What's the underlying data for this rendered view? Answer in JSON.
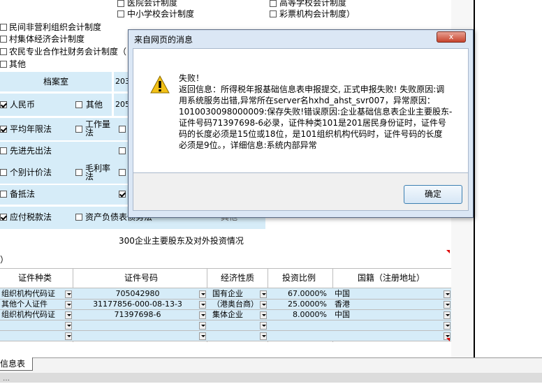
{
  "top_checks": [
    {
      "label": "医院会计制度",
      "checked": false
    },
    {
      "label": "高等学校会计制度",
      "checked": false
    },
    {
      "label": "中小学校会计制度",
      "checked": false
    },
    {
      "label": "彩票机构会计制度）",
      "checked": false
    }
  ],
  "left_checks": [
    {
      "label": "民间非营利组织会计制度",
      "checked": false
    },
    {
      "label": "村集体经济会计制度",
      "checked": false
    },
    {
      "label": "农民专业合作社财务会计制度（",
      "checked": false
    },
    {
      "label": "其他",
      "checked": false
    }
  ],
  "archive": {
    "label": "档案室",
    "value_partial": "203"
  },
  "currency": {
    "rmb": "人民币",
    "other": "其他",
    "value_partial": "205"
  },
  "methods": {
    "avg_life": "平均年限法",
    "workload": "工作量法",
    "fifo": "先进先出法",
    "individual": "个别计价法",
    "gross_margin": "毛利率法",
    "allowance": "备抵法",
    "tax_payable": "应付税款法",
    "balance_sheet_debt": "资产负债表债务法",
    "other_partial": "其他"
  },
  "section_title": "300企业主要股东及对外投资情况",
  "section_left_partial": "）",
  "table": {
    "headers": [
      "证件种类",
      "证件号码",
      "经济性质",
      "投资比例",
      "国籍（注册地址）"
    ],
    "rows": [
      {
        "type": "组织机构代码证",
        "number": "705042980",
        "nature": "国有企业",
        "ratio": "67.0000%",
        "country": "中国"
      },
      {
        "type": "其他个人证件",
        "number": "31177856-000-08-13-3",
        "nature": "（港奥台商）",
        "ratio": "25.0000%",
        "country": "香港"
      },
      {
        "type": "组织机构代码证",
        "number": "71397698-6",
        "nature": "集体企业",
        "ratio": "8.0000%",
        "country": "中国"
      },
      {
        "type": "",
        "number": "",
        "nature": "",
        "ratio": "",
        "country": ""
      },
      {
        "type": "",
        "number": "",
        "nature": "",
        "ratio": "",
        "country": ""
      }
    ]
  },
  "sheet_tab": "信息表",
  "status_partial": "…",
  "dialog": {
    "title": "来自网页的消息",
    "close": "x",
    "icon": "warning-icon",
    "lines": [
      "失败！",
      "返回信息：所得税年报基础信息表申报提交, 正式申报失败! 失败原因:调",
      "用系统服务出错,异常所在server名hxhd_ahst_svr007，异常原因：",
      "1010030098000009:保存失败!错误原因:企业基础信息表企业主要股东-",
      "证件号码71397698-6必录，证件种类101是201居民身份证时，证件号",
      "码的长度必须是15位或18位，是101组织机构代码时，证件号码的长度",
      "必须是9位。，详细信息:系统内部异常"
    ],
    "ok": "确定"
  },
  "colors": {
    "cell_blue": "#d6ecf8",
    "dialog_frame": "#dbe7f5",
    "close_red": "#c7442d"
  }
}
